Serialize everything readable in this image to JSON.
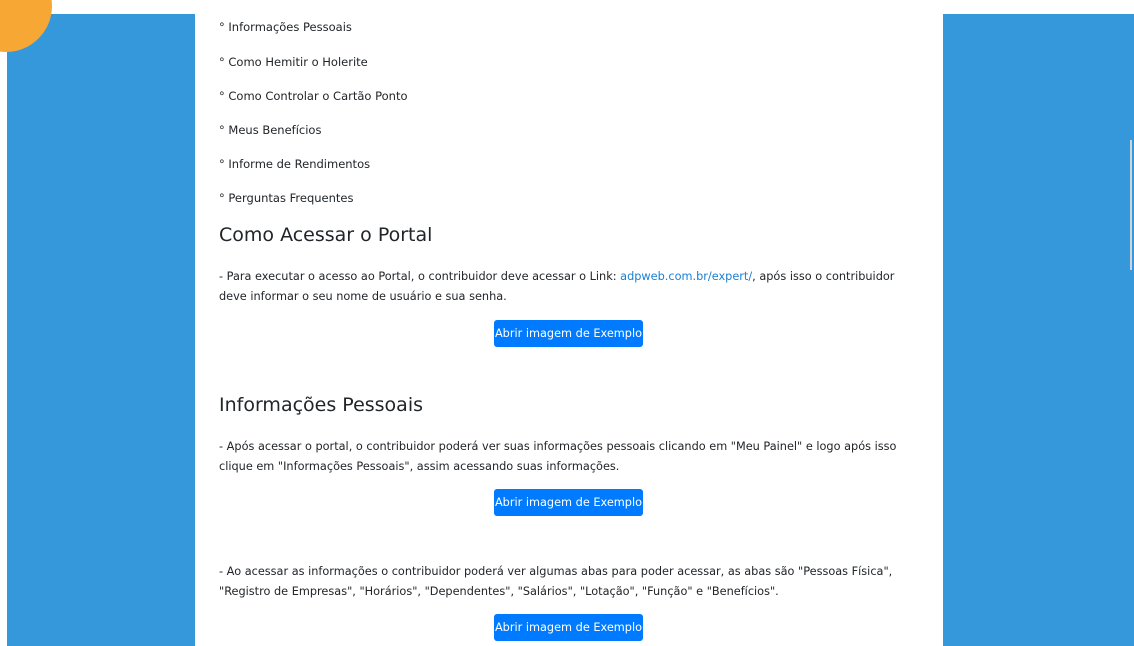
{
  "colors": {
    "side_panels": "#3498db",
    "corner_accent": "#f7a733",
    "link": "#1a7fd4",
    "button": "#007bff"
  },
  "index": [
    "° Informações Pessoais",
    "° Como Hemitir o Holerite",
    "° Como Controlar o Cartão Ponto",
    "° Meus Benefícios",
    "° Informe de Rendimentos",
    "° Perguntas Frequentes"
  ],
  "sections": {
    "access": {
      "title": "Como Acessar o Portal",
      "text_before_link": "- Para executar o acesso ao Portal, o contribuidor deve acessar o Link: ",
      "link": "adpweb.com.br/expert/",
      "text_after_link": ", após isso o contribuidor deve informar o seu nome de usuário e sua senha.",
      "button": "Abrir imagem de Exemplo"
    },
    "personal": {
      "title": "Informações Pessoais",
      "text": "- Após acessar o portal, o contribuidor poderá ver suas informações pessoais clicando em \"Meu Painel\" e logo após isso clique em \"Informações Pessoais\", assim acessando suas informações.",
      "button": "Abrir imagem de Exemplo",
      "text2": "- Ao acessar as informações o contribuidor poderá ver algumas abas para poder acessar, as abas são \"Pessoas Física\", \"Registro de Empresas\", \"Horários\", \"Dependentes\", \"Salários\", \"Lotação\", \"Função\" e \"Benefícios\".",
      "button2": "Abrir imagem de Exemplo"
    }
  }
}
